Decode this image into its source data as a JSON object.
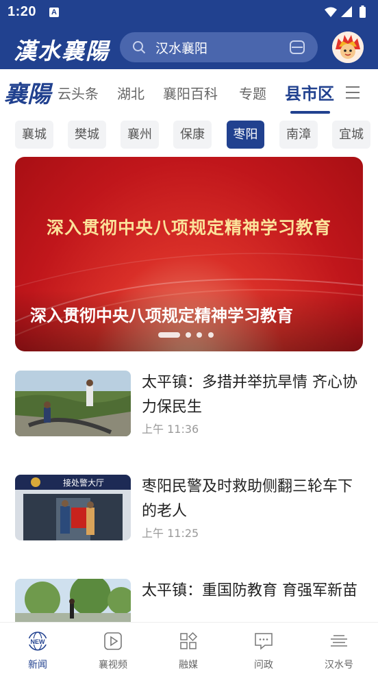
{
  "status_bar": {
    "time": "1:20",
    "notification_icon": "A"
  },
  "header": {
    "logo": "漢水襄陽",
    "search_text": "汉水襄阳",
    "colors": {
      "primary": "#21418f"
    }
  },
  "channels": {
    "logo": "襄陽",
    "items": [
      "云头条",
      "湖北",
      "襄阳百科",
      "专题",
      "县市区"
    ],
    "active": "县市区"
  },
  "counties": {
    "items": [
      "襄城",
      "樊城",
      "襄州",
      "保康",
      "枣阳",
      "南漳",
      "宜城"
    ],
    "active": "枣阳"
  },
  "banner": {
    "headline": "深入贯彻中央八项规定精神学习教育",
    "caption": "深入贯彻中央八项规定精神学习教育",
    "slide_count": 4,
    "active_slide": 1
  },
  "news": [
    {
      "title": "太平镇：多措并举抗旱情  齐心协力保民生",
      "time": "上午 11:36"
    },
    {
      "title": "枣阳民警及时救助侧翻三轮车下的老人",
      "time": "上午 11:25",
      "thumb_sign": "接处警大厅"
    },
    {
      "title": "太平镇：重国防教育 育强军新苗",
      "time": ""
    }
  ],
  "bottom_nav": {
    "items": [
      {
        "label": "新闻",
        "icon": "news-globe-icon",
        "badge": "NEW"
      },
      {
        "label": "襄视频",
        "icon": "play-icon"
      },
      {
        "label": "融媒",
        "icon": "grid-icon"
      },
      {
        "label": "问政",
        "icon": "chat-icon"
      },
      {
        "label": "汉水号",
        "icon": "lines-icon"
      }
    ],
    "active": "新闻"
  }
}
